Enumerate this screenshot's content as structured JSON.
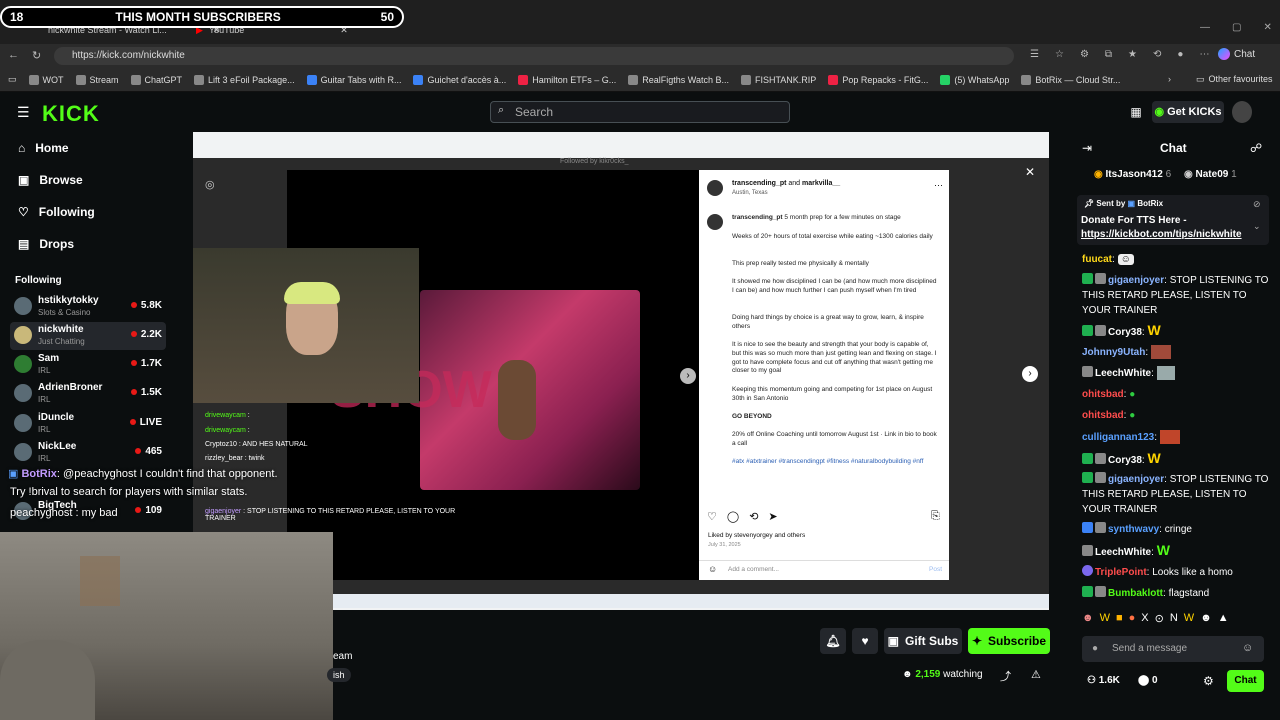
{
  "browser": {
    "tabs": [
      {
        "label": "nickwhite Stream - Watch Li..."
      },
      {
        "label": "YouTube"
      }
    ],
    "url": "https://kick.com/nickwhite",
    "bookmarks": [
      "WOT",
      "Stream",
      "ChatGPT",
      "Lift 3 eFoil Package...",
      "Guitar Tabs with R...",
      "Guichet d'accès à...",
      "Hamilton ETFs – G...",
      "RealFigths Watch B...",
      "FISHTANK.RIP",
      "Pop Repacks - FitG...",
      "(5) WhatsApp",
      "BotRix — Cloud Str..."
    ],
    "other_favourites": "Other favourites",
    "chat_label": "Chat"
  },
  "subcounter": {
    "left": "18",
    "title": "THIS MONTH SUBSCRIBERS",
    "right": "50"
  },
  "header": {
    "logo": "KICK",
    "search_placeholder": "Search",
    "get_kicks": "Get KICKs"
  },
  "sidebar": {
    "nav": [
      {
        "label": "Home",
        "icon": "home-icon"
      },
      {
        "label": "Browse",
        "icon": "browse-icon"
      },
      {
        "label": "Following",
        "icon": "heart-icon"
      },
      {
        "label": "Drops",
        "icon": "drops-icon"
      }
    ],
    "following_title": "Following",
    "channels": [
      {
        "name": "hstikkytokky",
        "category": "Slots & Casino",
        "viewers": "5.8K"
      },
      {
        "name": "nickwhite",
        "category": "Just Chatting",
        "viewers": "2.2K"
      },
      {
        "name": "Sam",
        "category": "IRL",
        "viewers": "1.7K"
      },
      {
        "name": "AdrienBroner",
        "category": "IRL",
        "viewers": "1.5K"
      },
      {
        "name": "iDuncle",
        "category": "IRL",
        "viewers": "LIVE"
      },
      {
        "name": "NickLee",
        "category": "IRL",
        "viewers": "465"
      },
      {
        "name": "BigTech",
        "category": "",
        "viewers": "109"
      }
    ]
  },
  "video": {
    "post_author": "transcending_pt",
    "post_coauthor": "markvilla__",
    "post_location": "Austin, Texas",
    "caption_head": "5 month prep for a few minutes on stage",
    "caption_lines": [
      "Weeks of 20+ hours of total exercise while eating ~1300 calories daily",
      "This prep really tested me physically & mentally",
      "It showed me how disciplined I can be (and how much more disciplined I can be) and how much further I can push myself when I'm tired",
      "Doing hard things by choice is a great way to grow, learn, & inspire others",
      "It is nice to see the beauty and strength that your body is capable of, but this was so much more than just getting lean and flexing on stage. I got to have complete focus and cut off anything that wasn't getting me closer to my goal",
      "Keeping this momentum going and competing for 1st place on August 30th in San Antonio",
      "GO BEYOND",
      "20% off Online Coaching until tomorrow August 1st · Link in bio to book a call",
      "#atx #atxtrainer #transcendingpt #fitness #naturalbodybuilding #nff"
    ],
    "liked_by": "Liked by stevenyorgey and others",
    "post_date": "July 31, 2025",
    "add_comment": "Add a comment...",
    "post_button": "Post",
    "followed_by": "Followed by kikr0cks_",
    "stage_text": "SHOW"
  },
  "overlay_chat": [
    {
      "user": "drivewaycam",
      "text": ""
    },
    {
      "user": "drivewaycam",
      "text": ""
    },
    {
      "user": "Cryptoz10",
      "text": "AND HES NATURAL"
    },
    {
      "user": "rizzley_bear",
      "text": "twink"
    },
    {
      "user": "gigaenjoyer",
      "text": "STOP LISTENING TO THIS RETARD PLEASE, LISTEN TO YOUR TRAINER"
    }
  ],
  "bot_overlay": {
    "line1_user": "BotRix",
    "line1_text": "@peachyghost I couldn't find that opponent.",
    "line2": "Try !brival to search for players with similar stats.",
    "line3_user": "peachyghost",
    "line3_text": "my bad"
  },
  "stream_info": {
    "title_fragment": "eam",
    "lang": "ish",
    "gift_subs": "Gift Subs",
    "subscribe": "Subscribe",
    "watching_count": "2,159",
    "watching_label": "watching"
  },
  "chat": {
    "title": "Chat",
    "top_gifters": [
      {
        "name": "ItsJason412",
        "count": "6"
      },
      {
        "name": "Nate09",
        "count": "1"
      }
    ],
    "pinned_sender": "BotRix",
    "pinned_text": "Donate For TTS Here -",
    "pinned_link": "https://kickbot.com/tips/nickwhite",
    "sent_by": "Sent by",
    "messages": [
      {
        "user": "fuucat",
        "text": "",
        "color": "#ffd91a"
      },
      {
        "user": "gigaenjoyer",
        "text": "STOP LISTENING TO THIS RETARD PLEASE, LISTEN TO YOUR TRAINER",
        "color": "#8ab4ff"
      },
      {
        "user": "Cory38",
        "text": "",
        "color": "#ffffff"
      },
      {
        "user": "Johnny9Utah",
        "text": "",
        "color": "#8ab4ff"
      },
      {
        "user": "LeechWhite",
        "text": "",
        "color": "#ffffff"
      },
      {
        "user": "ohitsbad",
        "text": "",
        "color": "#ff4d4d"
      },
      {
        "user": "ohitsbad",
        "text": "",
        "color": "#ff4d4d"
      },
      {
        "user": "culligannan123",
        "text": "",
        "color": "#5aa0ff"
      },
      {
        "user": "Cory38",
        "text": "",
        "color": "#ffffff"
      },
      {
        "user": "gigaenjoyer",
        "text": "STOP LISTENING TO THIS RETARD PLEASE, LISTEN TO YOUR TRAINER",
        "color": "#8ab4ff"
      },
      {
        "user": "synthwavy",
        "text": "cringe",
        "color": "#5aa0ff"
      },
      {
        "user": "LeechWhite",
        "text": "",
        "color": "#ffffff"
      },
      {
        "user": "TriplePoint",
        "text": "Looks like a homo",
        "color": "#ff4d4d"
      },
      {
        "user": "Bumbaklott",
        "text": "flagstand",
        "color": "#53fc18"
      }
    ],
    "input_placeholder": "Send a message",
    "viewers": "1.6K",
    "points": "0",
    "send_button": "Chat"
  },
  "colors": {
    "brand": "#53fc18",
    "bg": "#0b0e0f"
  }
}
